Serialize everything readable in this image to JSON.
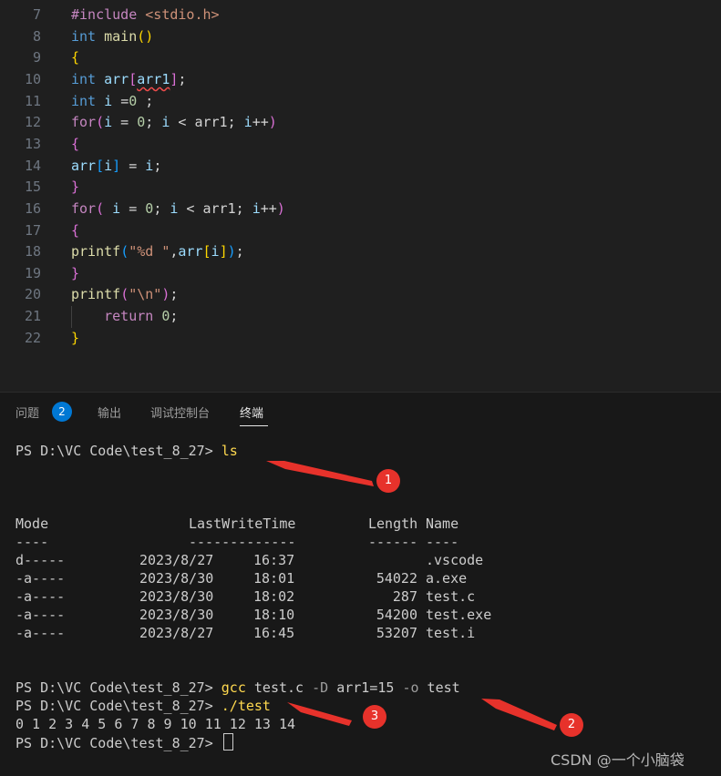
{
  "editor": {
    "lines": [
      {
        "num": "7",
        "tokens": [
          [
            "p",
            "#include "
          ],
          [
            "s",
            "<stdio.h>"
          ]
        ]
      },
      {
        "num": "8",
        "tokens": [
          [
            "k",
            "int "
          ],
          [
            "f",
            "main"
          ],
          [
            "br1",
            "()"
          ]
        ]
      },
      {
        "num": "9",
        "tokens": [
          [
            "br1",
            "{"
          ]
        ]
      },
      {
        "num": "10",
        "tokens": [
          [
            "k",
            "int "
          ],
          [
            "v",
            "arr"
          ],
          [
            "br2",
            "["
          ],
          [
            "sq",
            "arr1"
          ],
          [
            "br2",
            "]"
          ],
          [
            "d",
            ";"
          ]
        ]
      },
      {
        "num": "11",
        "tokens": [
          [
            "k",
            "int "
          ],
          [
            "v",
            "i "
          ],
          [
            "d",
            "="
          ],
          [
            "n",
            "0"
          ],
          [
            "d",
            " ;"
          ]
        ]
      },
      {
        "num": "12",
        "tokens": [
          [
            "pr",
            "for"
          ],
          [
            "br2",
            "("
          ],
          [
            "v",
            "i"
          ],
          [
            "d",
            " = "
          ],
          [
            "n",
            "0"
          ],
          [
            "d",
            "; "
          ],
          [
            "v",
            "i"
          ],
          [
            "d",
            " < arr1; "
          ],
          [
            "v",
            "i"
          ],
          [
            "d",
            "++"
          ],
          [
            "br2",
            ")"
          ]
        ]
      },
      {
        "num": "13",
        "tokens": [
          [
            "br2",
            "{"
          ]
        ]
      },
      {
        "num": "14",
        "tokens": [
          [
            "v",
            "arr"
          ],
          [
            "br3",
            "["
          ],
          [
            "v",
            "i"
          ],
          [
            "br3",
            "]"
          ],
          [
            "d",
            " = "
          ],
          [
            "v",
            "i"
          ],
          [
            "d",
            ";"
          ]
        ]
      },
      {
        "num": "15",
        "tokens": [
          [
            "br2",
            "}"
          ]
        ]
      },
      {
        "num": "16",
        "tokens": [
          [
            "pr",
            "for"
          ],
          [
            "br2",
            "("
          ],
          [
            "d",
            " "
          ],
          [
            "v",
            "i"
          ],
          [
            "d",
            " = "
          ],
          [
            "n",
            "0"
          ],
          [
            "d",
            "; "
          ],
          [
            "v",
            "i"
          ],
          [
            "d",
            " < arr1; "
          ],
          [
            "v",
            "i"
          ],
          [
            "d",
            "++"
          ],
          [
            "br2",
            ")"
          ]
        ]
      },
      {
        "num": "17",
        "tokens": [
          [
            "br2",
            "{"
          ]
        ]
      },
      {
        "num": "18",
        "tokens": [
          [
            "f",
            "printf"
          ],
          [
            "br3",
            "("
          ],
          [
            "s",
            "\"%d \""
          ],
          [
            "d",
            ","
          ],
          [
            "v",
            "arr"
          ],
          [
            "br1",
            "["
          ],
          [
            "v",
            "i"
          ],
          [
            "br1",
            "]"
          ],
          [
            "br3",
            ")"
          ],
          [
            "d",
            ";"
          ]
        ]
      },
      {
        "num": "19",
        "tokens": [
          [
            "br2",
            "}"
          ]
        ]
      },
      {
        "num": "20",
        "tokens": [
          [
            "f",
            "printf"
          ],
          [
            "br2",
            "("
          ],
          [
            "s",
            "\"\\n\""
          ],
          [
            "br2",
            ")"
          ],
          [
            "d",
            ";"
          ]
        ]
      },
      {
        "num": "21",
        "tokens": [
          [
            "d",
            "    "
          ],
          [
            "pr",
            "return "
          ],
          [
            "n",
            "0"
          ],
          [
            "d",
            ";"
          ]
        ]
      },
      {
        "num": "22",
        "tokens": [
          [
            "br1",
            "}"
          ]
        ]
      }
    ]
  },
  "panel": {
    "tabs": [
      {
        "label": "问题",
        "badge": "2"
      },
      {
        "label": "输出"
      },
      {
        "label": "调试控制台"
      },
      {
        "label": "终端",
        "active": true
      }
    ]
  },
  "terminal": {
    "prompt": "PS D:\\VC Code\\test_8_27>",
    "cmd1": "ls",
    "headers": {
      "mode": "Mode",
      "lwt": "LastWriteTime",
      "length": "Length",
      "name": "Name"
    },
    "underlines": {
      "mode": "----",
      "lwt": "-------------",
      "length": "------",
      "name": "----"
    },
    "files": [
      {
        "mode": "d-----",
        "date": "2023/8/27",
        "time": "16:37",
        "length": "",
        "name": ".vscode"
      },
      {
        "mode": "-a----",
        "date": "2023/8/30",
        "time": "18:01",
        "length": "54022",
        "name": "a.exe"
      },
      {
        "mode": "-a----",
        "date": "2023/8/30",
        "time": "18:02",
        "length": "287",
        "name": "test.c"
      },
      {
        "mode": "-a----",
        "date": "2023/8/30",
        "time": "18:10",
        "length": "54200",
        "name": "test.exe"
      },
      {
        "mode": "-a----",
        "date": "2023/8/27",
        "time": "16:45",
        "length": "53207",
        "name": "test.i"
      }
    ],
    "cmd2": {
      "exe": "gcc",
      "a1": " test.c ",
      "f1": "-D",
      "a2": " arr1=15 ",
      "f2": "-o",
      "a3": " test"
    },
    "cmd3": "./test",
    "output": "0 1 2 3 4 5 6 7 8 9 10 11 12 13 14"
  },
  "annotations": {
    "markers": [
      "1",
      "2",
      "3"
    ],
    "color": "#e7322b"
  },
  "watermark": "CSDN @一个小脑袋"
}
